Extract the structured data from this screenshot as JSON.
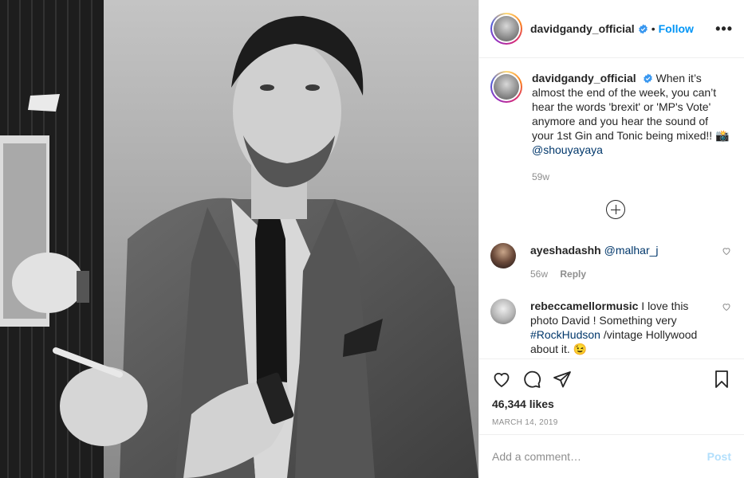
{
  "post": {
    "username": "davidgandy_official",
    "dot": "•",
    "follow_label": "Follow",
    "more_label": "•••",
    "caption_user": "davidgandy_official",
    "caption_text": "When it’s almost the end of the week, you can’t hear the words 'brexit' or 'MP's Vote' anymore and you hear the sound of your 1st Gin and Tonic being mixed!! 📸",
    "caption_mention": "@shouyayaya",
    "caption_time": "59w"
  },
  "comments": [
    {
      "user": "ayeshadashh",
      "mention": "@malhar_j",
      "text": "",
      "time": "56w",
      "reply": "Reply"
    },
    {
      "user": "rebeccamellormusic",
      "text_a": "I love this photo David ! Something very",
      "hashtag": "#RockHudson",
      "text_b": "/vintage Hollywood about it. 😉"
    }
  ],
  "actions": {
    "likes": "46,344 likes",
    "date": "MARCH 14, 2019",
    "comment_placeholder": "Add a comment…",
    "post_label": "Post"
  },
  "icons": [
    "verified-badge-icon",
    "heart-icon",
    "comment-icon",
    "share-icon",
    "bookmark-icon",
    "plus-circle-icon",
    "heart-small-icon"
  ],
  "colors": {
    "accent": "#0095f6",
    "link": "#00376b",
    "muted": "#8e8e8e",
    "post_disabled": "#b2dffc"
  }
}
